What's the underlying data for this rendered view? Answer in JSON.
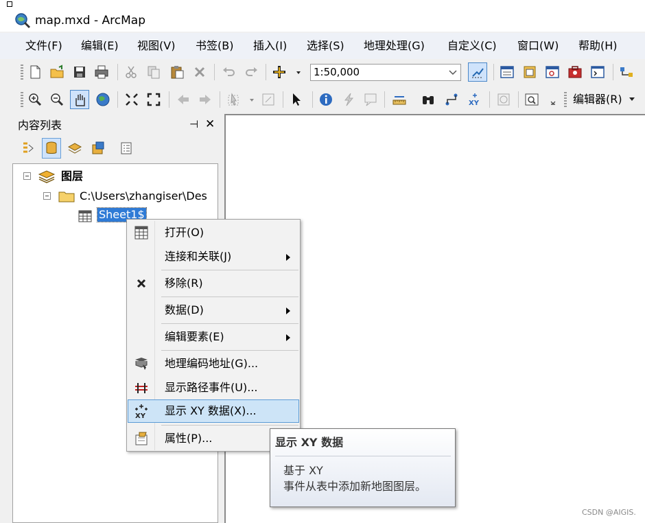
{
  "window": {
    "title": "map.mxd - ArcMap"
  },
  "menubar": [
    "文件(F)",
    "编辑(E)",
    "视图(V)",
    "书签(B)",
    "插入(I)",
    "选择(S)",
    "地理处理(G)",
    "自定义(C)",
    "窗口(W)",
    "帮助(H)"
  ],
  "toolbar": {
    "scale": "1:50,000",
    "editor_label": "编辑器(R)"
  },
  "toc": {
    "title": "内容列表",
    "pin_glyph": "⊣",
    "close_glyph": "✕",
    "layers_label": "图层",
    "folder_label": "C:\\Users\\zhangiser\\Des",
    "table_label": "Sheet1$"
  },
  "context_menu": {
    "items": [
      {
        "label": "打开(O)",
        "icon": "table-icon"
      },
      {
        "label": "连接和关联(J)",
        "submenu": true
      },
      {
        "label": "移除(R)",
        "icon": "remove-icon"
      },
      {
        "label": "数据(D)",
        "submenu": true
      },
      {
        "label": "编辑要素(E)",
        "submenu": true
      },
      {
        "label": "地理编码地址(G)...",
        "icon": "geocode-icon"
      },
      {
        "label": "显示路径事件(U)...",
        "icon": "route-event-icon"
      },
      {
        "label": "显示 XY 数据(X)...",
        "icon": "xy-data-icon",
        "highlighted": true
      },
      {
        "label": "属性(P)...",
        "icon": "properties-icon"
      }
    ]
  },
  "tooltip": {
    "title": "显示 XY 数据",
    "line1": "基于 XY",
    "line2": "事件从表中添加新地图图层。"
  },
  "watermark": "CSDN @AIGIS."
}
